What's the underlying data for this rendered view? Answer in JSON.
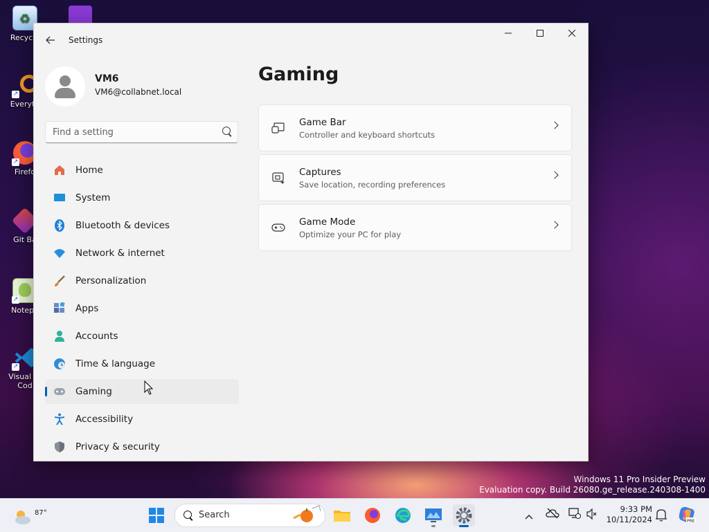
{
  "desktop": {
    "icons": [
      {
        "label": "Recycle"
      },
      {
        "label": "Everyth"
      },
      {
        "label": "Firefo"
      },
      {
        "label": "Git Ba"
      },
      {
        "label": "Notepa"
      },
      {
        "label": "Visual St\nCod"
      }
    ],
    "watermark": {
      "line1": "Windows 11 Pro Insider Preview",
      "line2": "Evaluation copy. Build 26080.ge_release.240308-1400"
    }
  },
  "window": {
    "title": "Settings",
    "user": {
      "name": "VM6",
      "email": "VM6@collabnet.local"
    },
    "search": {
      "placeholder": "Find a setting"
    },
    "nav": [
      {
        "label": "Home",
        "icon": "home-icon"
      },
      {
        "label": "System",
        "icon": "system-icon"
      },
      {
        "label": "Bluetooth & devices",
        "icon": "bluetooth-icon"
      },
      {
        "label": "Network & internet",
        "icon": "wifi-icon"
      },
      {
        "label": "Personalization",
        "icon": "brush-icon"
      },
      {
        "label": "Apps",
        "icon": "apps-icon"
      },
      {
        "label": "Accounts",
        "icon": "accounts-icon"
      },
      {
        "label": "Time & language",
        "icon": "globe-clock-icon"
      },
      {
        "label": "Gaming",
        "icon": "gamepad-icon",
        "selected": true
      },
      {
        "label": "Accessibility",
        "icon": "accessibility-icon"
      },
      {
        "label": "Privacy & security",
        "icon": "shield-icon"
      }
    ],
    "page_title": "Gaming",
    "cards": [
      {
        "title": "Game Bar",
        "subtitle": "Controller and keyboard shortcuts",
        "icon": "game-bar-icon"
      },
      {
        "title": "Captures",
        "subtitle": "Save location, recording preferences",
        "icon": "capture-icon"
      },
      {
        "title": "Game Mode",
        "subtitle": "Optimize your PC for play",
        "icon": "game-mode-icon"
      }
    ]
  },
  "taskbar": {
    "weather_temp": "87°",
    "search_label": "Search",
    "clock_time": "9:33 PM",
    "clock_date": "10/11/2024"
  },
  "colors": {
    "accent": "#005fb8",
    "window_bg": "#f3f3f3"
  }
}
